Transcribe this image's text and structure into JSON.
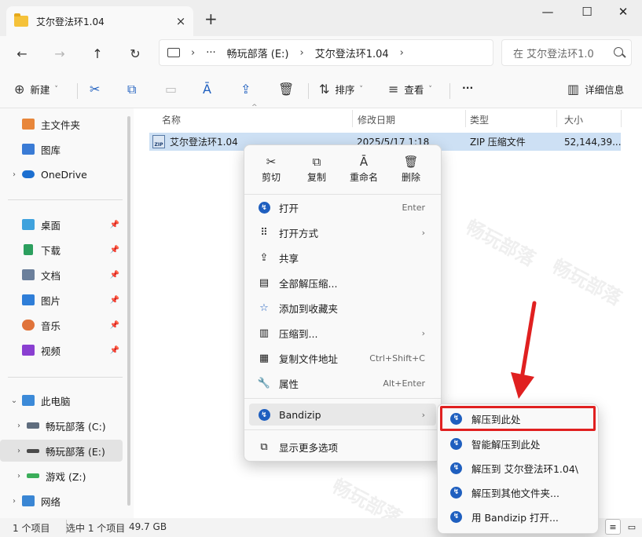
{
  "window": {
    "tab_title": "艾尔登法环1.04",
    "tab_close_icon": "×",
    "new_tab_icon": "+",
    "minimize_icon": "—",
    "maximize_icon": "☐",
    "close_icon": "✕"
  },
  "nav": {
    "back_icon": "←",
    "forward_icon": "→",
    "up_icon": "↑",
    "refresh_icon": "↻",
    "more_icon": "···",
    "path": [
      "畅玩部落 (E:)",
      "艾尔登法环1.04"
    ],
    "chevron": "›",
    "search_placeholder": "在 艾尔登法环1.0",
    "search_icon": "search-icon"
  },
  "toolbar": {
    "new_label": "新建",
    "sort_label": "排序",
    "view_label": "查看",
    "more_label": "···",
    "details_label": "详细信息",
    "new_icon": "⊕",
    "cut_icon": "✂",
    "copy_icon": "⧉",
    "paste_icon": "▭",
    "rename_icon": "Ā",
    "share_icon": "⇪",
    "delete_icon": "🗑",
    "sort_icon": "⇅",
    "view_icon": "≡",
    "details_icon": "▥",
    "caret": "˅"
  },
  "sidebar": {
    "items": [
      {
        "label": "主文件夹",
        "icon": "home-icon"
      },
      {
        "label": "图库",
        "icon": "gallery-icon"
      },
      {
        "label": "OneDrive",
        "icon": "cloud-icon"
      },
      {
        "label": "桌面",
        "icon": "desktop-icon"
      },
      {
        "label": "下载",
        "icon": "download-icon"
      },
      {
        "label": "文档",
        "icon": "document-icon"
      },
      {
        "label": "图片",
        "icon": "pictures-icon"
      },
      {
        "label": "音乐",
        "icon": "music-icon"
      },
      {
        "label": "视频",
        "icon": "video-icon"
      },
      {
        "label": "此电脑",
        "icon": "pc-icon"
      },
      {
        "label": "畅玩部落 (C:)",
        "icon": "drive-icon"
      },
      {
        "label": "畅玩部落 (E:)",
        "icon": "drive-icon"
      },
      {
        "label": "游戏 (Z:)",
        "icon": "drive-icon"
      },
      {
        "label": "网络",
        "icon": "network-icon"
      }
    ],
    "pin_icon": "📌",
    "expand_icon": "›",
    "expanded_icon": "⌄"
  },
  "columns": {
    "name": "名称",
    "date": "修改日期",
    "type": "类型",
    "size": "大小"
  },
  "file": {
    "name": "艾尔登法环1.04",
    "date": "2025/5/17 1:18",
    "type": "ZIP 压缩文件",
    "size": "52,144,39..."
  },
  "context_menu": {
    "quick_actions": [
      {
        "label": "剪切",
        "icon": "✂"
      },
      {
        "label": "复制",
        "icon": "⧉"
      },
      {
        "label": "重命名",
        "icon": "Ā"
      },
      {
        "label": "删除",
        "icon": "🗑"
      }
    ],
    "items": [
      {
        "label": "打开",
        "shortcut": "Enter",
        "icon": "bandizip-icon"
      },
      {
        "label": "打开方式",
        "shortcut": "",
        "icon": "open-with-icon"
      },
      {
        "label": "共享",
        "shortcut": "",
        "icon": "share-icon"
      },
      {
        "label": "全部解压缩...",
        "shortcut": "",
        "icon": "extract-all-icon"
      },
      {
        "label": "添加到收藏夹",
        "shortcut": "",
        "icon": "star-icon"
      },
      {
        "label": "压缩到...",
        "shortcut": "",
        "icon": "compress-icon"
      },
      {
        "label": "复制文件地址",
        "shortcut": "Ctrl+Shift+C",
        "icon": "copy-path-icon"
      },
      {
        "label": "属性",
        "shortcut": "Alt+Enter",
        "icon": "properties-icon"
      },
      {
        "label": "Bandizip",
        "shortcut": "",
        "icon": "bandizip-icon"
      },
      {
        "label": "显示更多选项",
        "shortcut": "",
        "icon": "more-options-icon"
      }
    ]
  },
  "submenu": {
    "items": [
      {
        "label": "解压到此处"
      },
      {
        "label": "智能解压到此处"
      },
      {
        "label": "解压到 艾尔登法环1.04\\"
      },
      {
        "label": "解压到其他文件夹..."
      },
      {
        "label": "用 Bandizip 打开..."
      }
    ]
  },
  "statusbar": {
    "count": "1 个项目",
    "selected": "选中 1 个项目",
    "size": "49.7 GB"
  },
  "colors": {
    "accent": "#1f5fbf",
    "selection": "#cde0f4",
    "highlight_box": "#e02020"
  }
}
